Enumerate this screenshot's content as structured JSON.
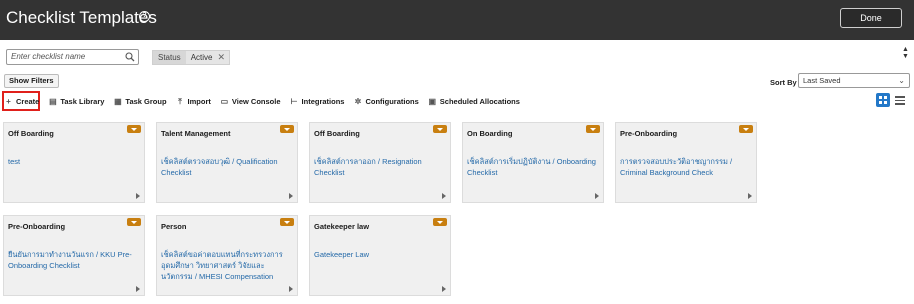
{
  "header": {
    "title": "Checklist Templates",
    "done_label": "Done"
  },
  "search": {
    "placeholder": "Enter checklist name"
  },
  "filter_chip": {
    "key": "Status",
    "value": "Active"
  },
  "show_filters_label": "Show Filters",
  "sort": {
    "label": "Sort By",
    "value": "Last Saved"
  },
  "toolbar": {
    "create": "Create",
    "task_library": "Task Library",
    "task_group": "Task Group",
    "import": "Import",
    "view_console": "View Console",
    "integrations": "Integrations",
    "configurations": "Configurations",
    "scheduled_allocations": "Scheduled Allocations"
  },
  "cards": [
    {
      "category": "Off Boarding",
      "name": "test"
    },
    {
      "category": "Talent Management",
      "name": "เช็คลิสต์ตรวจสอบวุฒิ / Qualification Checklist"
    },
    {
      "category": "Off Boarding",
      "name": "เช็คลิสต์การลาออก / Resignation Checklist"
    },
    {
      "category": "On Boarding",
      "name": "เช็คลิสต์การเริ่มปฏิบัติงาน / Onboarding Checklist"
    },
    {
      "category": "Pre-Onboarding",
      "name": "การตรวจสอบประวัติอาชญากรรม / Criminal Background Check"
    },
    {
      "category": "Pre-Onboarding",
      "name": "ยืนยันการมาทำงานวันแรก / KKU Pre-Onboarding Checklist"
    },
    {
      "category": "Person",
      "name": "เช็คลิสต์ขอค่าตอบแทนที่กระทรวงการอุดมศึกษา วิทยาศาสตร์ วิจัยและนวัตกรรม / MHESI Compensation"
    },
    {
      "category": "Gatekeeper law",
      "name": "Gatekeeper Law"
    }
  ],
  "colors": {
    "header_bg": "#333333",
    "link": "#2469a8",
    "badge": "#c87f10",
    "highlight": "#e0201b",
    "grid_active": "#2378c8"
  }
}
